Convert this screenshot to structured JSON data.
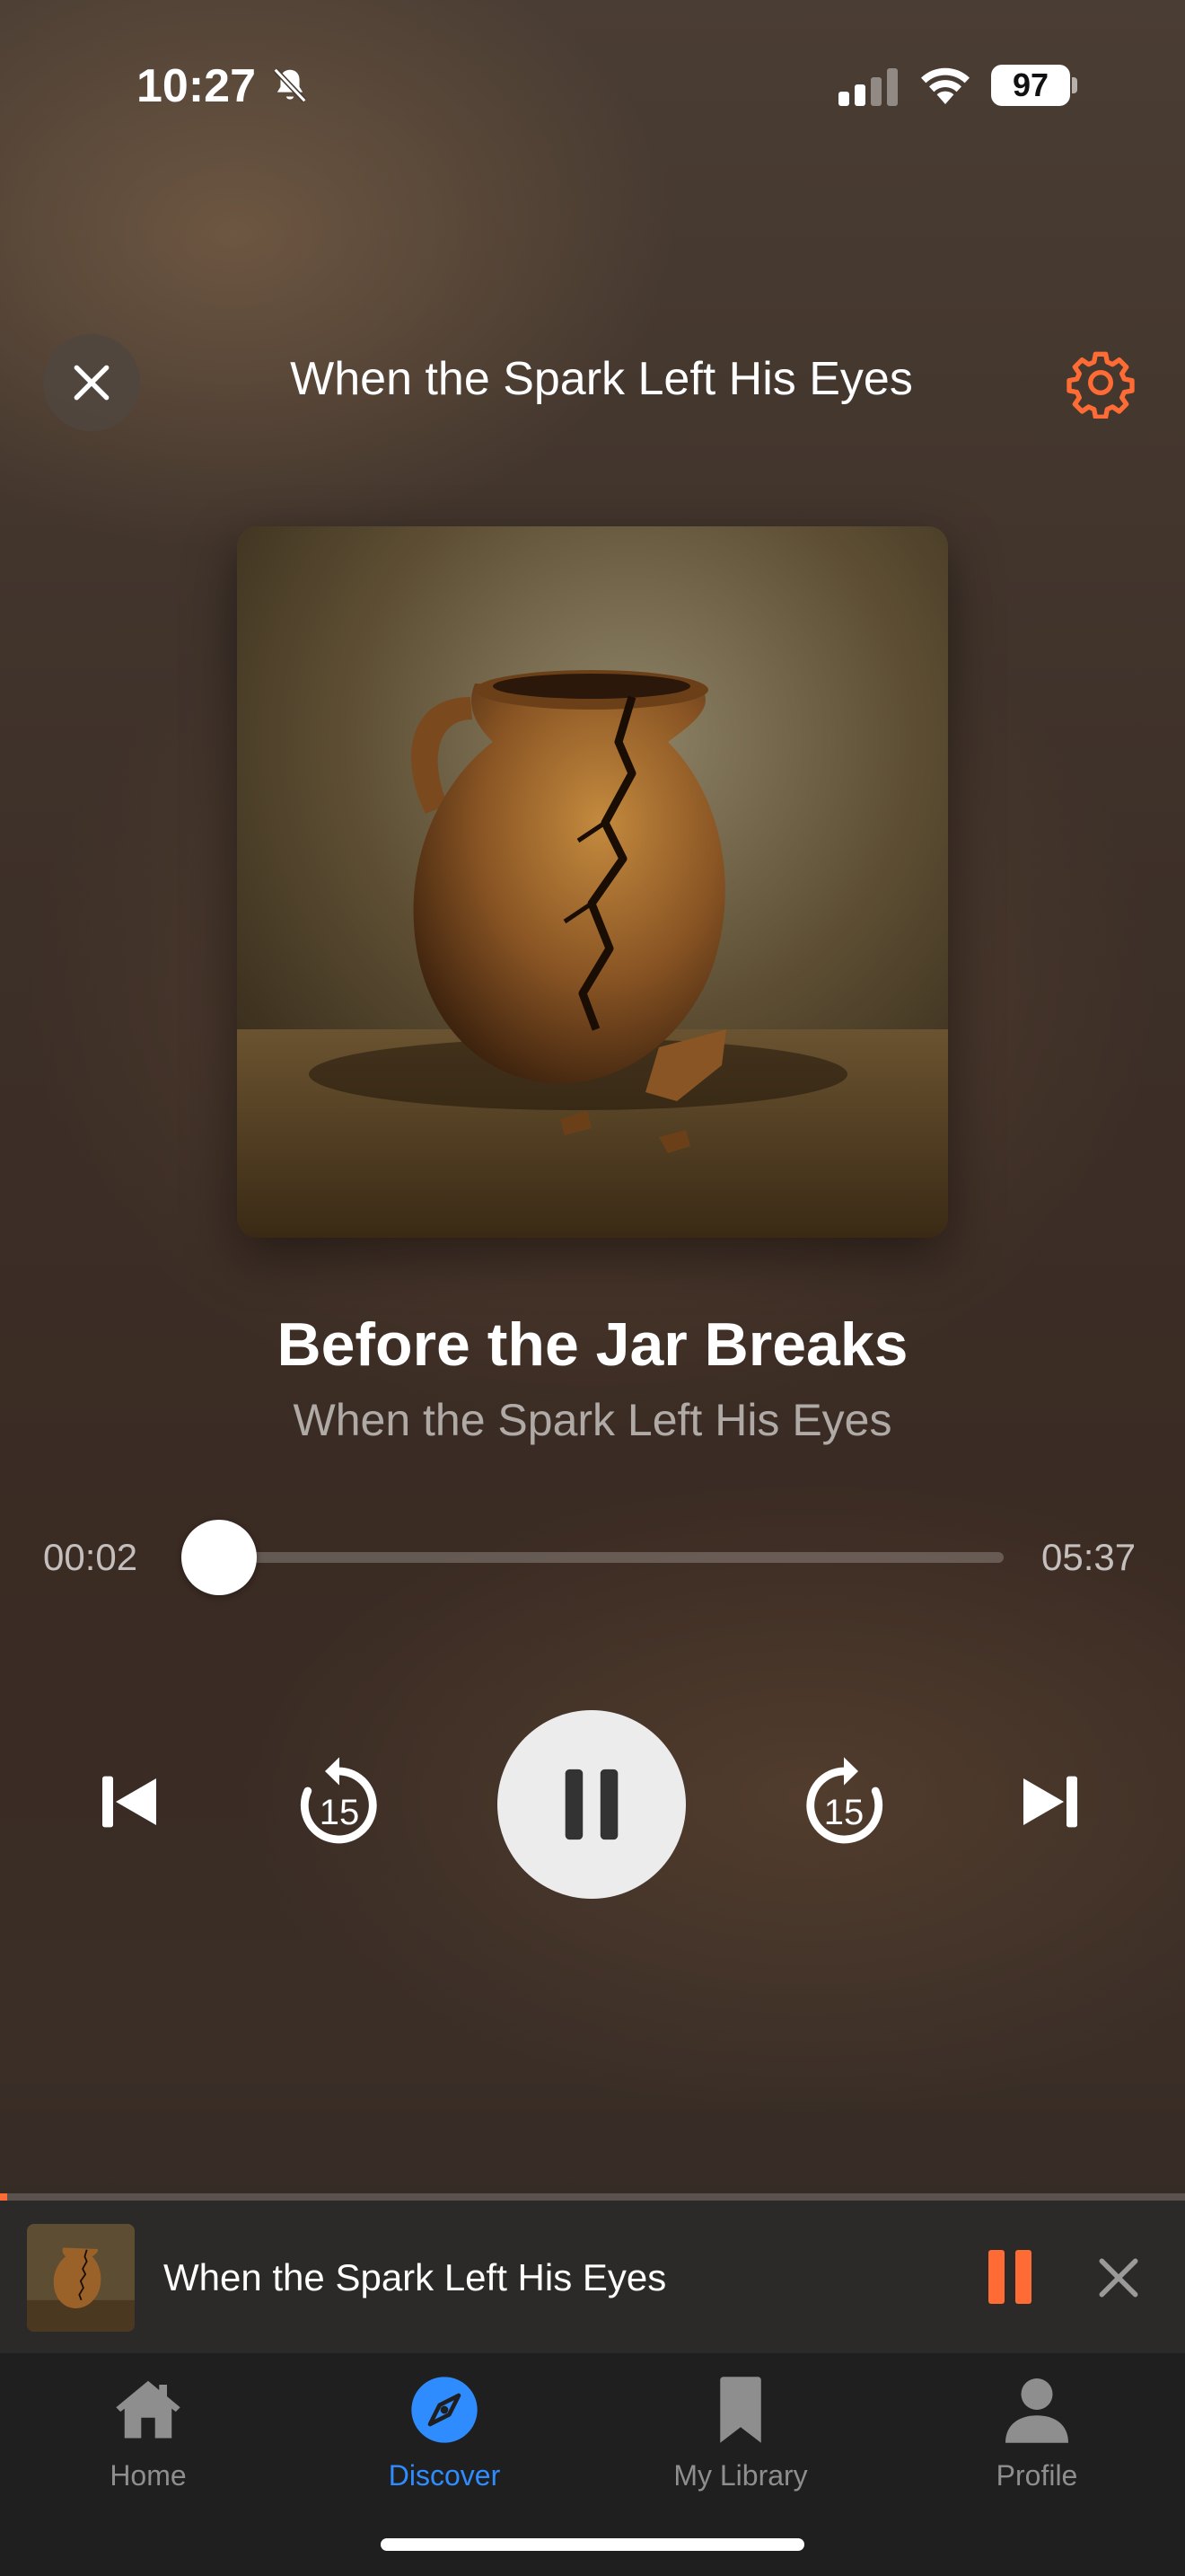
{
  "status_bar": {
    "time": "10:27",
    "battery": "97",
    "icons": [
      "bell-off-icon",
      "cellular-signal-icon",
      "wifi-icon",
      "battery-icon"
    ]
  },
  "header": {
    "title": "When the Spark Left His Eyes",
    "close_icon": "close-icon",
    "settings_icon": "gear-icon",
    "accent": "#ff6b35"
  },
  "now_playing": {
    "track_title": "Before the Jar Breaks",
    "album": "When the Spark Left His Eyes",
    "artwork": "cracked clay jar painting"
  },
  "progress": {
    "elapsed": "00:02",
    "total": "05:37",
    "fraction": 0.006
  },
  "controls": {
    "previous_icon": "skip-previous-icon",
    "rewind_label": "15",
    "play_pause_icon": "pause-icon",
    "forward_label": "15",
    "next_icon": "skip-next-icon"
  },
  "mini_player": {
    "title": "When the Spark Left His Eyes",
    "progress_fraction": 0.006,
    "pause_icon": "pause-icon",
    "close_icon": "close-icon",
    "accent": "#ff6b35"
  },
  "tab_bar": {
    "tabs": [
      {
        "label": "Home",
        "icon": "home-icon",
        "active": false
      },
      {
        "label": "Discover",
        "icon": "compass-icon",
        "active": true
      },
      {
        "label": "My Library",
        "icon": "bookmark-icon",
        "active": false
      },
      {
        "label": "Profile",
        "icon": "person-icon",
        "active": false
      }
    ],
    "active_color": "#2f8cff",
    "inactive_color": "#8e8e8e"
  }
}
